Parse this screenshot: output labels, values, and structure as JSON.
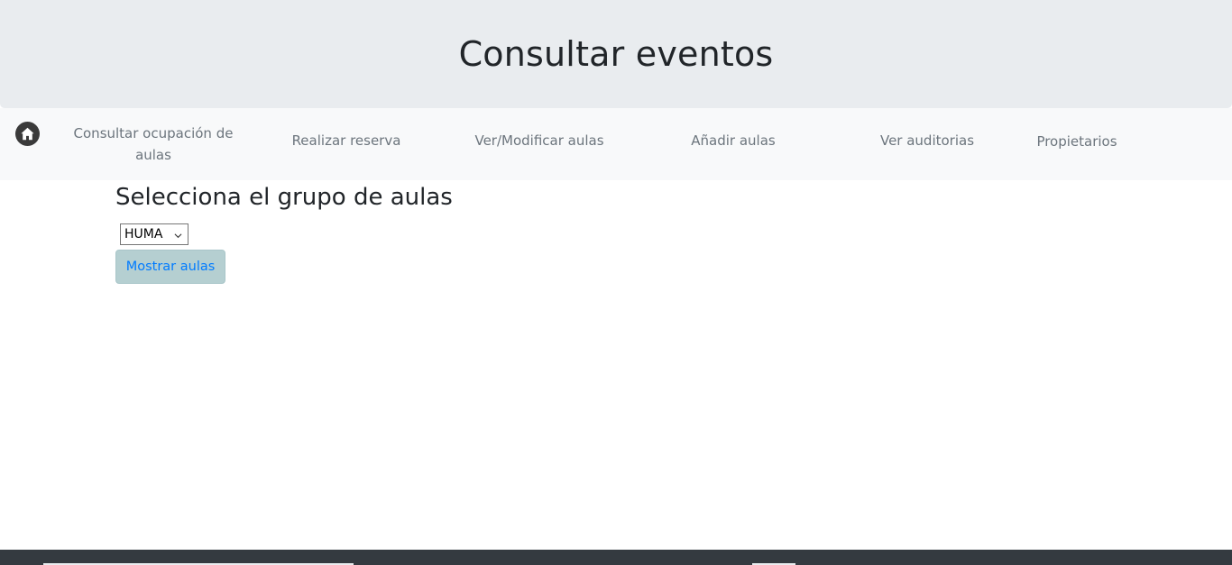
{
  "header": {
    "title": "Consultar eventos"
  },
  "nav": {
    "home_icon": "home-icon",
    "items": [
      {
        "label": "Consultar ocupación de aulas"
      },
      {
        "label": "Realizar reserva"
      },
      {
        "label": "Ver/Modificar aulas"
      },
      {
        "label": "Añadir aulas"
      },
      {
        "label": "Ver auditorias"
      },
      {
        "label": "Propietarios"
      }
    ]
  },
  "main": {
    "heading": "Selecciona el grupo de aulas",
    "group_select": {
      "selected": "HUMA"
    },
    "show_button_label": "Mostrar aulas"
  },
  "colors": {
    "header_bg": "#e9ecef",
    "navbar_bg": "#f8f9fa",
    "nav_text": "#6c757d",
    "button_bg": "#b5cfd1",
    "button_text": "#007bff",
    "footer_bg": "#343a40"
  }
}
